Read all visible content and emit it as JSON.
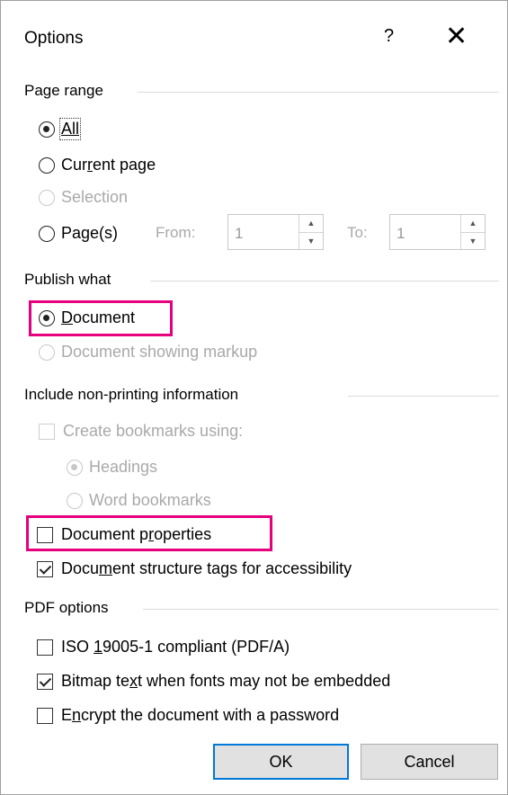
{
  "window": {
    "title": "Options",
    "help_label": "?",
    "close_label": "✕"
  },
  "page_range": {
    "heading": "Page range",
    "all": "All",
    "current_page_pre": "Cur",
    "current_page_key": "r",
    "current_page_post": "ent page",
    "selection": "Selection",
    "pages_pre": "Pa",
    "pages_key": "g",
    "pages_post": "e(s)",
    "from_label": "From:",
    "from_value": "1",
    "to_label": "To:",
    "to_value": "1"
  },
  "publish_what": {
    "heading": "Publish what",
    "document_key": "D",
    "document_post": "ocument",
    "document_markup": "Document showing markup"
  },
  "non_printing": {
    "heading": "Include non-printing information",
    "create_bookmarks": "Create bookmarks using:",
    "headings": "Headings",
    "word_bookmarks": "Word bookmarks",
    "doc_props_pre": "Document p",
    "doc_props_key": "r",
    "doc_props_post": "operties",
    "structure_pre": "Docu",
    "structure_key": "m",
    "structure_post": "ent structure tags for accessibility"
  },
  "pdf_options": {
    "heading": "PDF options",
    "iso_pre": "ISO ",
    "iso_key": "1",
    "iso_post": "9005-1 compliant (PDF/A)",
    "bitmap_pre": "Bitmap te",
    "bitmap_key": "x",
    "bitmap_post": "t when fonts may not be embedded",
    "encrypt_pre": "E",
    "encrypt_key": "n",
    "encrypt_post": "crypt the document with a password"
  },
  "buttons": {
    "ok": "OK",
    "cancel": "Cancel"
  }
}
